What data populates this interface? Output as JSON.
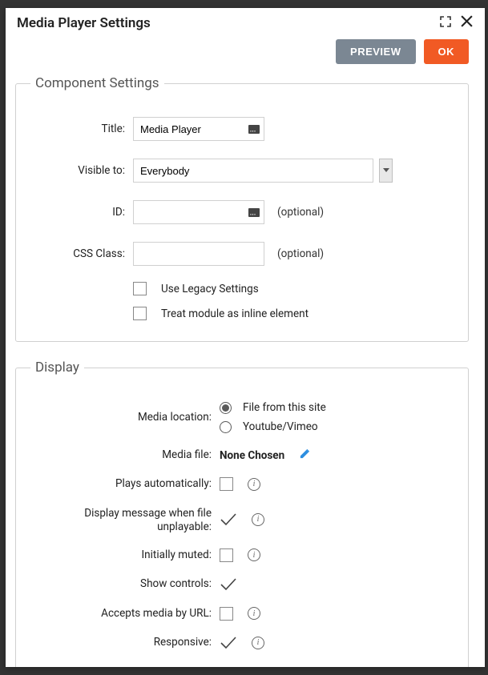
{
  "dialog": {
    "title": "Media Player Settings",
    "buttons": {
      "preview": "PREVIEW",
      "ok": "OK"
    }
  },
  "component": {
    "legend": "Component Settings",
    "labels": {
      "title": "Title:",
      "visible": "Visible to:",
      "id": "ID:",
      "css": "CSS Class:"
    },
    "values": {
      "title": "Media Player",
      "visible": "Everybody",
      "id": "",
      "css": ""
    },
    "optional": "(optional)",
    "legacy": "Use Legacy Settings",
    "inline": "Treat module as inline element"
  },
  "display": {
    "legend": "Display",
    "labels": {
      "location": "Media location:",
      "file": "Media file:",
      "plays": "Plays automatically:",
      "unplayable": "Display message when file unplayable:",
      "muted": "Initially muted:",
      "controls": "Show controls:",
      "url": "Accepts media by URL:",
      "responsive": "Responsive:"
    },
    "radio": {
      "site": "File from this site",
      "yt": "Youtube/Vimeo"
    },
    "fileValue": "None Chosen"
  }
}
